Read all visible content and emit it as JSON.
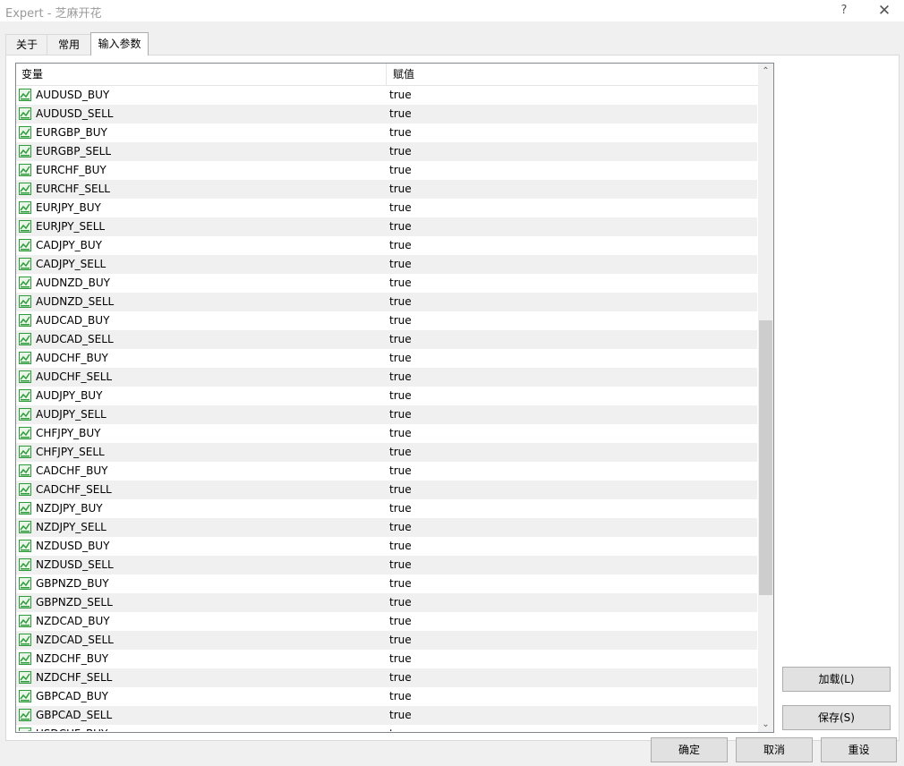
{
  "window": {
    "title": "Expert - 芝麻开花",
    "help_glyph": "?",
    "close_glyph": "✕"
  },
  "tabs": [
    {
      "label": "关于",
      "active": false
    },
    {
      "label": "常用",
      "active": false
    },
    {
      "label": "输入参数",
      "active": true
    }
  ],
  "table": {
    "columns": {
      "name": "变量",
      "value": "赋值"
    },
    "row_icon": "parameter-chart-icon",
    "rows": [
      {
        "name": "AUDUSD_BUY",
        "value": "true"
      },
      {
        "name": "AUDUSD_SELL",
        "value": "true"
      },
      {
        "name": "EURGBP_BUY",
        "value": "true"
      },
      {
        "name": "EURGBP_SELL",
        "value": "true"
      },
      {
        "name": "EURCHF_BUY",
        "value": "true"
      },
      {
        "name": "EURCHF_SELL",
        "value": "true"
      },
      {
        "name": "EURJPY_BUY",
        "value": "true"
      },
      {
        "name": "EURJPY_SELL",
        "value": "true"
      },
      {
        "name": "CADJPY_BUY",
        "value": "true"
      },
      {
        "name": "CADJPY_SELL",
        "value": "true"
      },
      {
        "name": "AUDNZD_BUY",
        "value": "true"
      },
      {
        "name": "AUDNZD_SELL",
        "value": "true"
      },
      {
        "name": "AUDCAD_BUY",
        "value": "true"
      },
      {
        "name": "AUDCAD_SELL",
        "value": "true"
      },
      {
        "name": "AUDCHF_BUY",
        "value": "true"
      },
      {
        "name": "AUDCHF_SELL",
        "value": "true"
      },
      {
        "name": "AUDJPY_BUY",
        "value": "true"
      },
      {
        "name": "AUDJPY_SELL",
        "value": "true"
      },
      {
        "name": "CHFJPY_BUY",
        "value": "true"
      },
      {
        "name": "CHFJPY_SELL",
        "value": "true"
      },
      {
        "name": "CADCHF_BUY",
        "value": "true"
      },
      {
        "name": "CADCHF_SELL",
        "value": "true"
      },
      {
        "name": "NZDJPY_BUY",
        "value": "true"
      },
      {
        "name": "NZDJPY_SELL",
        "value": "true"
      },
      {
        "name": "NZDUSD_BUY",
        "value": "true"
      },
      {
        "name": "NZDUSD_SELL",
        "value": "true"
      },
      {
        "name": "GBPNZD_BUY",
        "value": "true"
      },
      {
        "name": "GBPNZD_SELL",
        "value": "true"
      },
      {
        "name": "NZDCAD_BUY",
        "value": "true"
      },
      {
        "name": "NZDCAD_SELL",
        "value": "true"
      },
      {
        "name": "NZDCHF_BUY",
        "value": "true"
      },
      {
        "name": "NZDCHF_SELL",
        "value": "true"
      },
      {
        "name": "GBPCAD_BUY",
        "value": "true"
      },
      {
        "name": "GBPCAD_SELL",
        "value": "true"
      },
      {
        "name": "USDCHF_BUY",
        "value": "true"
      }
    ]
  },
  "scrollbar": {
    "up_glyph": "⌃",
    "down_glyph": "⌄"
  },
  "buttons": {
    "load": "加载(L)",
    "save": "保存(S)",
    "ok": "确定",
    "cancel": "取消",
    "reset": "重设"
  },
  "colors": {
    "row_alt": "#f0f0f0",
    "icon_green": "#2e9b3a",
    "title_gray": "#9a9a9a"
  }
}
